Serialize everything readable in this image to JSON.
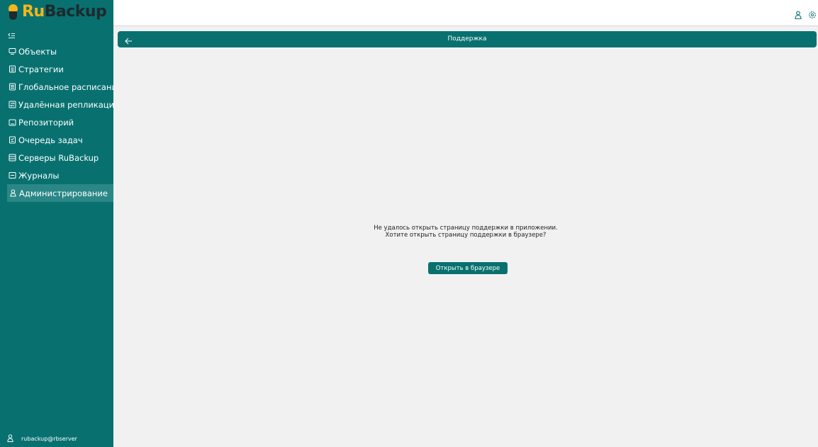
{
  "app": {
    "logo_ru": "Ru",
    "logo_backup": "Backup"
  },
  "sidebar": {
    "items": [
      {
        "label": "Объекты",
        "icon": "monitor-icon"
      },
      {
        "label": "Стратегии",
        "icon": "strategy-icon"
      },
      {
        "label": "Глобальное расписание",
        "icon": "schedule-icon"
      },
      {
        "label": "Удалённая репликация",
        "icon": "replication-icon"
      },
      {
        "label": "Репозиторий",
        "icon": "repository-icon"
      },
      {
        "label": "Очередь задач",
        "icon": "queue-icon"
      },
      {
        "label": "Серверы RuBackup",
        "icon": "servers-icon"
      },
      {
        "label": "Журналы",
        "icon": "journals-icon"
      },
      {
        "label": "Администрирование",
        "icon": "admin-icon",
        "active": true
      }
    ],
    "user": "rubackup@rbserver"
  },
  "header": {
    "title": "Поддержка"
  },
  "content": {
    "message_line1": "Не удалось открыть страницу поддержки в приложении.",
    "message_line2": "Хотите открыть страницу поддержки в браузере?",
    "open_button": "Открыть в браузере"
  },
  "colors": {
    "accent": "#087170",
    "active_item": "#2a8786",
    "logo_yellow": "#f4b61a",
    "background": "#f1f1f1"
  }
}
